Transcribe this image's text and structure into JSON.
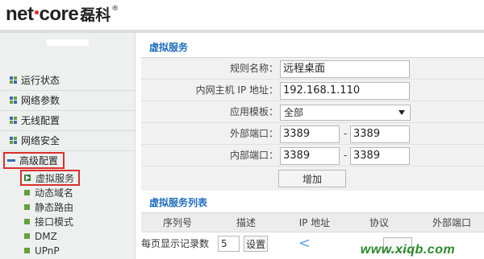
{
  "brand": {
    "logo_left": "net",
    "logo_right": "core",
    "logo_cn": "磊科",
    "registered": "®"
  },
  "sidebar": {
    "items": [
      {
        "label": "运行状态"
      },
      {
        "label": "网络参数"
      },
      {
        "label": "无线配置"
      },
      {
        "label": "网络安全"
      },
      {
        "label": "高级配置"
      }
    ],
    "sub_items": [
      {
        "label": "虚拟服务"
      },
      {
        "label": "动态域名"
      },
      {
        "label": "静态路由"
      },
      {
        "label": "接口模式"
      },
      {
        "label": "DMZ"
      },
      {
        "label": "UPnP"
      }
    ]
  },
  "virtual_service": {
    "section_title": "虚拟服务",
    "rule_name_label": "规则名称：",
    "rule_name_value": "远程桌面",
    "host_ip_label": "内网主机 IP 地址：",
    "host_ip_value": "192.168.1.110",
    "template_label": "应用模板：",
    "template_value": "全部",
    "ext_port_label": "外部端口：",
    "ext_port_start": "3389",
    "ext_port_end": "3389",
    "int_port_label": "内部端口：",
    "int_port_start": "3389",
    "int_port_end": "3389",
    "range_dash": "-",
    "add_button": "增加"
  },
  "service_list": {
    "section_title": "虚拟服务列表",
    "columns": [
      "序列号",
      "描述",
      "IP 地址",
      "协议",
      "外部端口"
    ],
    "per_page_label": "每页显示记录数",
    "per_page_value": "5",
    "set_button": "设置",
    "prev_arrow": "<"
  },
  "watermark": "www.xiqb.com",
  "colors": {
    "section_title": "#1f6dbf",
    "highlight_border": "#d9302c",
    "sidebar_bg": "#eef0ef",
    "watermark": "#2a8a2a"
  }
}
